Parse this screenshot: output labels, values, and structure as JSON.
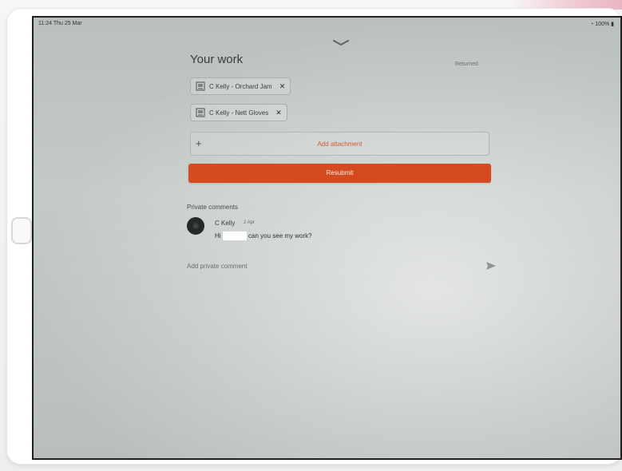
{
  "status_bar": {
    "time": "11:24 Thu 25 Mar",
    "right": "⁠⁠◔ 100% ▮"
  },
  "page": {
    "title": "Your work",
    "title_right": "Returned"
  },
  "attachments": [
    {
      "label": "C Kelly - Orchard Jam",
      "icon": "file-icon"
    },
    {
      "label": "C Kelly - Nett Gloves",
      "icon": "file-icon"
    }
  ],
  "actions": {
    "add_attachment": "Add attachment",
    "primary": "Resubmit"
  },
  "comments": {
    "section_label": "Private comments",
    "items": [
      {
        "author": "C Kelly",
        "time": "2 Apr",
        "text_prefix": "Hi",
        "text_rest": "can you see my work?"
      }
    ],
    "input_placeholder": "Add private comment"
  },
  "colors": {
    "accent": "#d44b20",
    "screen_bg": "#c4cac8"
  }
}
